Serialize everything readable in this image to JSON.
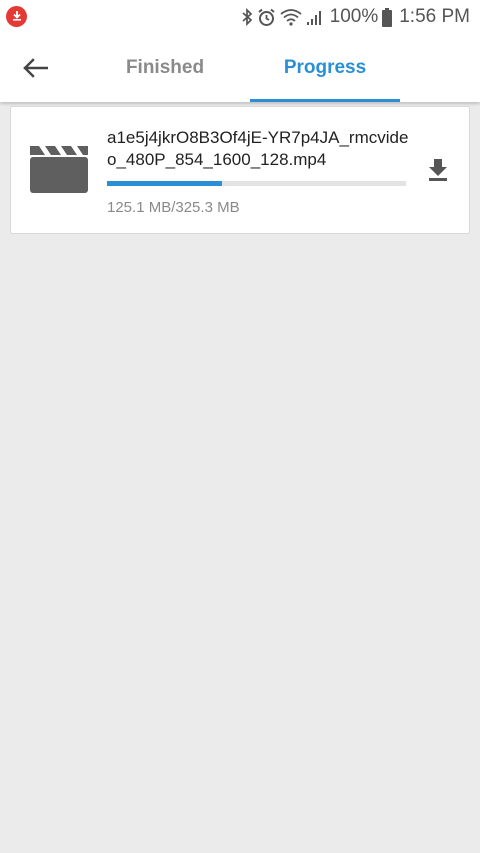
{
  "status_bar": {
    "battery_percent": "100%",
    "time": "1:56 PM",
    "icons": [
      "download-notification-icon",
      "bluetooth-icon",
      "alarm-icon",
      "wifi-icon",
      "signal-icon",
      "battery-icon"
    ]
  },
  "app_bar": {
    "back_icon": "arrow-left-icon",
    "tabs": [
      {
        "label": "Finished",
        "active": false
      },
      {
        "label": "Progress",
        "active": true
      }
    ]
  },
  "downloads": [
    {
      "file_name": "a1e5j4jkrO8B3Of4jE-YR7p4JA_rmcvideo_480P_854_1600_128.mp4",
      "size_text": "125.1 MB/325.3 MB",
      "progress_fraction": 0.385,
      "icon": "video-clapper-icon",
      "action_icon": "download-icon"
    }
  ],
  "colors": {
    "accent": "#2b8fd6",
    "background": "#ebebeb",
    "inactive_tab": "#8a8a8a",
    "notification": "#e53935"
  }
}
